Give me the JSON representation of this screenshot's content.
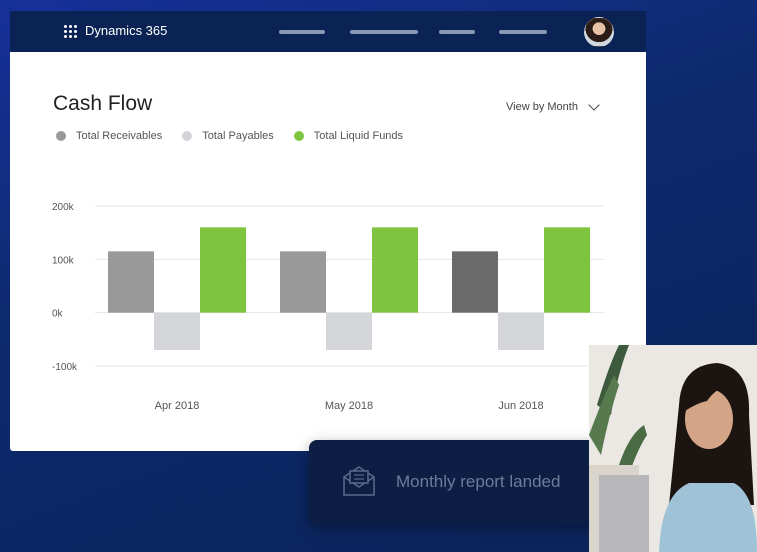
{
  "app": {
    "title": "Dynamics 365"
  },
  "card": {
    "title": "Cash Flow",
    "view_by": "View by Month"
  },
  "chart_data": {
    "type": "bar",
    "categories": [
      "Apr 2018",
      "May 2018",
      "Jun 2018"
    ],
    "series": [
      {
        "name": "Total Receivables",
        "color": "#999999",
        "values": [
          115,
          115,
          115
        ]
      },
      {
        "name": "Total Payables",
        "color": "#d4d5d8",
        "values": [
          -70,
          -70,
          -70
        ]
      },
      {
        "name": "Total Liquid Funds",
        "color": "#7fc441",
        "values": [
          160,
          160,
          160
        ]
      }
    ],
    "highlight": {
      "series": 0,
      "index": 2,
      "color": "#6b6b6b"
    },
    "yticks": [
      "200k",
      "100k",
      "0k",
      "-100k"
    ],
    "ytick_values": [
      200,
      100,
      0,
      -100
    ],
    "ylim": [
      -100,
      200
    ],
    "grid": true,
    "legend": "top-left"
  },
  "toast": {
    "text": "Monthly report landed"
  },
  "colors": {
    "brand_bar": "#0b2354",
    "toast_bg": "#0c1e44"
  }
}
